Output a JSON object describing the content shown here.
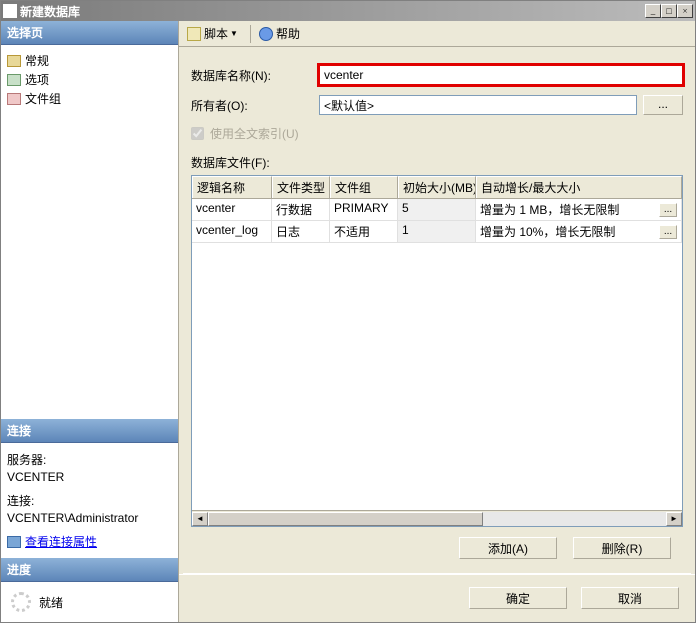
{
  "window": {
    "title": "新建数据库"
  },
  "sidebar": {
    "select_page_header": "选择页",
    "items": [
      {
        "label": "常规"
      },
      {
        "label": "选项"
      },
      {
        "label": "文件组"
      }
    ],
    "connection_header": "连接",
    "server_label": "服务器:",
    "server_value": "VCENTER",
    "conn_label": "连接:",
    "conn_value": "VCENTER\\Administrator",
    "view_props_link": "查看连接属性",
    "progress_header": "进度",
    "progress_status": "就绪"
  },
  "toolbar": {
    "script_label": "脚本",
    "help_label": "帮助"
  },
  "form": {
    "dbname_label": "数据库名称(N):",
    "dbname_value": "vcenter",
    "owner_label": "所有者(O):",
    "owner_value": "<默认值>",
    "browse_label": "...",
    "fulltext_label": "使用全文索引(U)",
    "files_label": "数据库文件(F):"
  },
  "grid": {
    "columns": {
      "name": "逻辑名称",
      "type": "文件类型",
      "fg": "文件组",
      "size": "初始大小(MB)",
      "grow": "自动增长/最大大小"
    },
    "rows": [
      {
        "name": "vcenter",
        "type": "行数据",
        "fg": "PRIMARY",
        "size": "5",
        "grow": "增量为 1 MB，增长无限制"
      },
      {
        "name": "vcenter_log",
        "type": "日志",
        "fg": "不适用",
        "size": "1",
        "grow": "增量为 10%，增长无限制"
      }
    ],
    "dots": "..."
  },
  "actions": {
    "add": "添加(A)",
    "remove": "删除(R)"
  },
  "dialog": {
    "ok": "确定",
    "cancel": "取消"
  }
}
